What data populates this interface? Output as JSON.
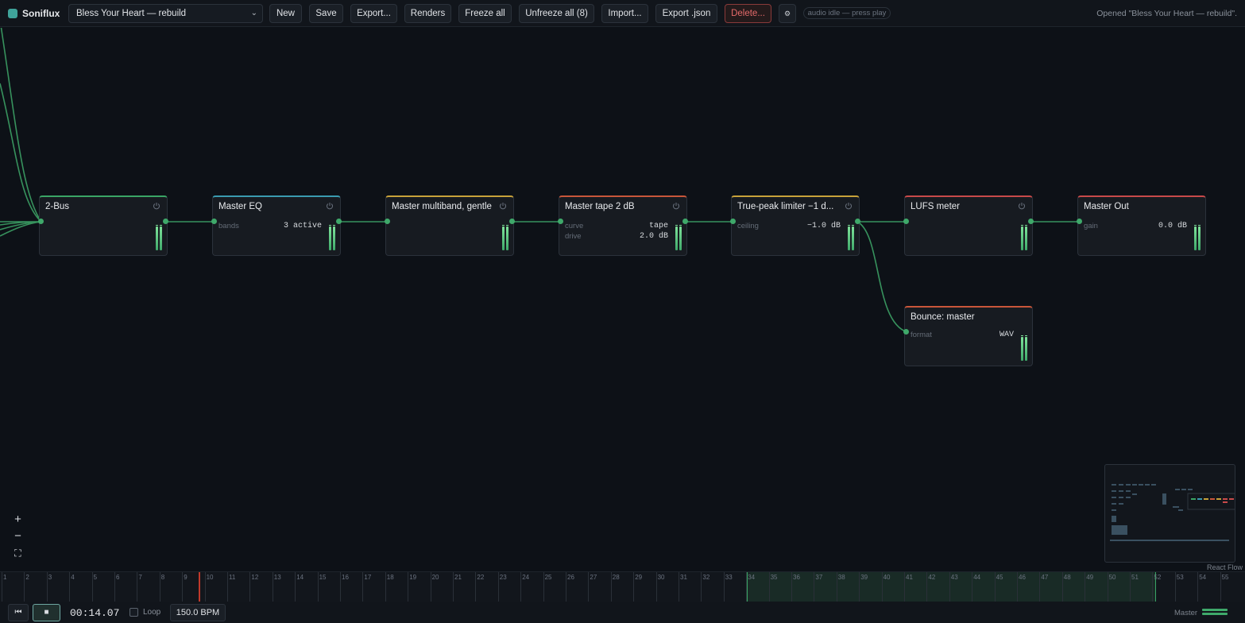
{
  "app": {
    "name": "Soniflux"
  },
  "toolbar": {
    "project": "Bless Your Heart — rebuild",
    "buttons": {
      "new": "New",
      "save": "Save",
      "export": "Export...",
      "renders": "Renders",
      "freeze_all": "Freeze all",
      "unfreeze_all": "Unfreeze all (8)",
      "import": "Import...",
      "export_json": "Export .json",
      "delete": "Delete...",
      "settings": "⚙"
    },
    "audio_status": "audio idle — press play",
    "status_message": "Opened \"Bless Your Heart — rebuild\"."
  },
  "nodes": [
    {
      "title": "2-Bus",
      "accent": "#3aa565",
      "params": []
    },
    {
      "title": "Master EQ",
      "accent": "#3a9bb0",
      "params": [
        {
          "label": "bands",
          "value": "3 active"
        }
      ]
    },
    {
      "title": "Master multiband, gentle",
      "accent": "#c8a23a",
      "params": []
    },
    {
      "title": "Master tape 2 dB",
      "accent": "#c8563a",
      "params": [
        {
          "label": "curve",
          "value": "tape"
        },
        {
          "label": "drive",
          "value": "2.0 dB"
        }
      ]
    },
    {
      "title": "True-peak limiter −1 d...",
      "accent": "#c8a23a",
      "params": [
        {
          "label": "ceiling",
          "value": "−1.0 dB"
        }
      ]
    },
    {
      "title": "LUFS meter",
      "accent": "#c84a4a",
      "params": []
    },
    {
      "title": "Master Out",
      "accent": "#c84a4a",
      "params": [
        {
          "label": "gain",
          "value": "0.0 dB"
        }
      ]
    },
    {
      "title": "Bounce: master",
      "accent": "#c8563a",
      "params": [
        {
          "label": "format",
          "value": "WAV"
        }
      ]
    }
  ],
  "zoom": {
    "zoom_in": "+",
    "zoom_out": "−",
    "fit": "⛶"
  },
  "minimap": {
    "attribution": "React Flow"
  },
  "timeline": {
    "bars": [
      "1",
      "2",
      "3",
      "4",
      "5",
      "6",
      "7",
      "8",
      "9",
      "10",
      "11",
      "12",
      "13",
      "14",
      "15",
      "16",
      "17",
      "18",
      "19",
      "20",
      "21",
      "22",
      "23",
      "24",
      "25",
      "26",
      "27",
      "28",
      "29",
      "30",
      "31",
      "32",
      "33",
      "34",
      "35",
      "36",
      "37",
      "38",
      "39",
      "40",
      "41",
      "42",
      "43",
      "44",
      "45",
      "46",
      "47",
      "48",
      "49",
      "50",
      "51",
      "52",
      "53",
      "54",
      "55"
    ]
  },
  "transport": {
    "rewind": "⏮",
    "stop": "■",
    "timecode": "00:14.07",
    "loop_label": "Loop",
    "bpm": "150.0 BPM",
    "master_label": "Master"
  },
  "colors": {
    "accent_green": "#3fa96a",
    "danger": "#e46a6a",
    "playhead": "#c0392b"
  }
}
